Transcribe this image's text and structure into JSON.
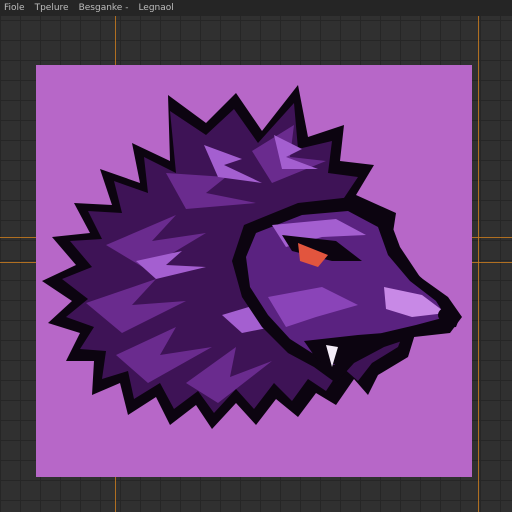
{
  "menubar": {
    "items": [
      {
        "label": "Fiole"
      },
      {
        "label": "Tpelure"
      },
      {
        "label": "Besganke -"
      },
      {
        "label": "Legnaol"
      }
    ]
  },
  "canvas": {
    "artwork": "purple-wolf-mascot",
    "colors": {
      "background": "#b767c8",
      "fur_dark": "#3e1356",
      "fur_mid": "#6a2b8e",
      "fur_light": "#a45fd0",
      "outline": "#0c0410",
      "eye": "#e2553e",
      "guides": "#c77a1e"
    }
  }
}
